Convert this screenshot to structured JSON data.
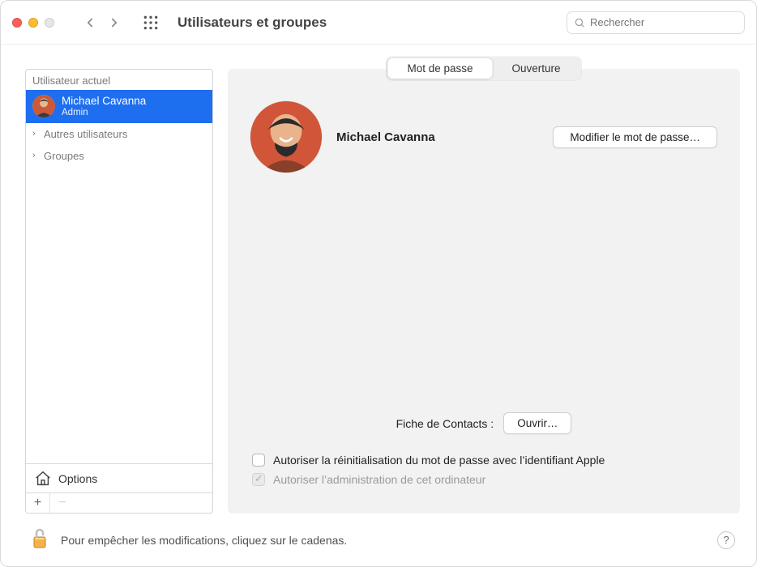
{
  "window": {
    "title": "Utilisateurs et groupes",
    "search_placeholder": "Rechercher"
  },
  "sidebar": {
    "current_user_header": "Utilisateur actuel",
    "current_user": {
      "name": "Michael Cavanna",
      "role": "Admin"
    },
    "other_users_label": "Autres utilisateurs",
    "groups_label": "Groupes",
    "options_label": "Options",
    "add_label": "+",
    "remove_label": "−"
  },
  "tabs": {
    "password": "Mot de passe",
    "login": "Ouverture",
    "active": "password"
  },
  "main": {
    "username": "Michael Cavanna",
    "change_password_button": "Modifier le mot de passe…",
    "contacts_label": "Fiche de Contacts :",
    "open_button": "Ouvrir…",
    "checkbox_reset_apple_id": "Autoriser la réinitialisation du mot de passe avec l’identifiant Apple",
    "checkbox_admin": "Autoriser l’administration de cet ordinateur",
    "reset_apple_id_checked": false,
    "admin_checked": true
  },
  "footer": {
    "lock_text": "Pour empêcher les modifications, cliquez sur le cadenas."
  }
}
